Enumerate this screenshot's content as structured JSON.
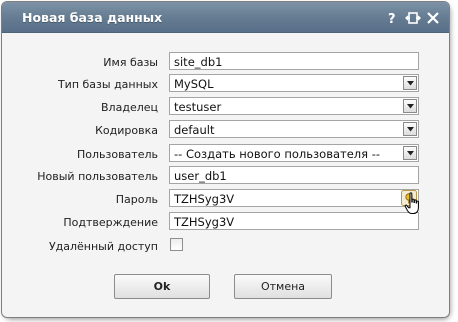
{
  "dialog": {
    "title": "Новая база данных",
    "title_buttons": [
      "help-icon",
      "maximize-icon",
      "close-icon"
    ]
  },
  "form": {
    "db_name": {
      "label": "Имя базы",
      "value": "site_db1"
    },
    "db_type": {
      "label": "Тип базы данных",
      "value": "MySQL"
    },
    "owner": {
      "label": "Владелец",
      "value": "testuser"
    },
    "encoding": {
      "label": "Кодировка",
      "value": "default"
    },
    "user": {
      "label": "Пользователь",
      "value": "-- Создать нового пользователя --"
    },
    "new_user": {
      "label": "Новый пользователь",
      "value": "user_db1"
    },
    "password": {
      "label": "Пароль",
      "value": "TZHSyg3V",
      "generate_icon": "key-generate-icon"
    },
    "confirm": {
      "label": "Подтверждение",
      "value": "TZHSyg3V"
    },
    "remote_access": {
      "label": "Удалённый доступ",
      "checked": false
    }
  },
  "buttons": {
    "ok": "Ok",
    "cancel": "Отмена"
  },
  "colors": {
    "titlebar": "#6a8097",
    "body": "#f4f4f4",
    "title_text": "#ffffff"
  }
}
